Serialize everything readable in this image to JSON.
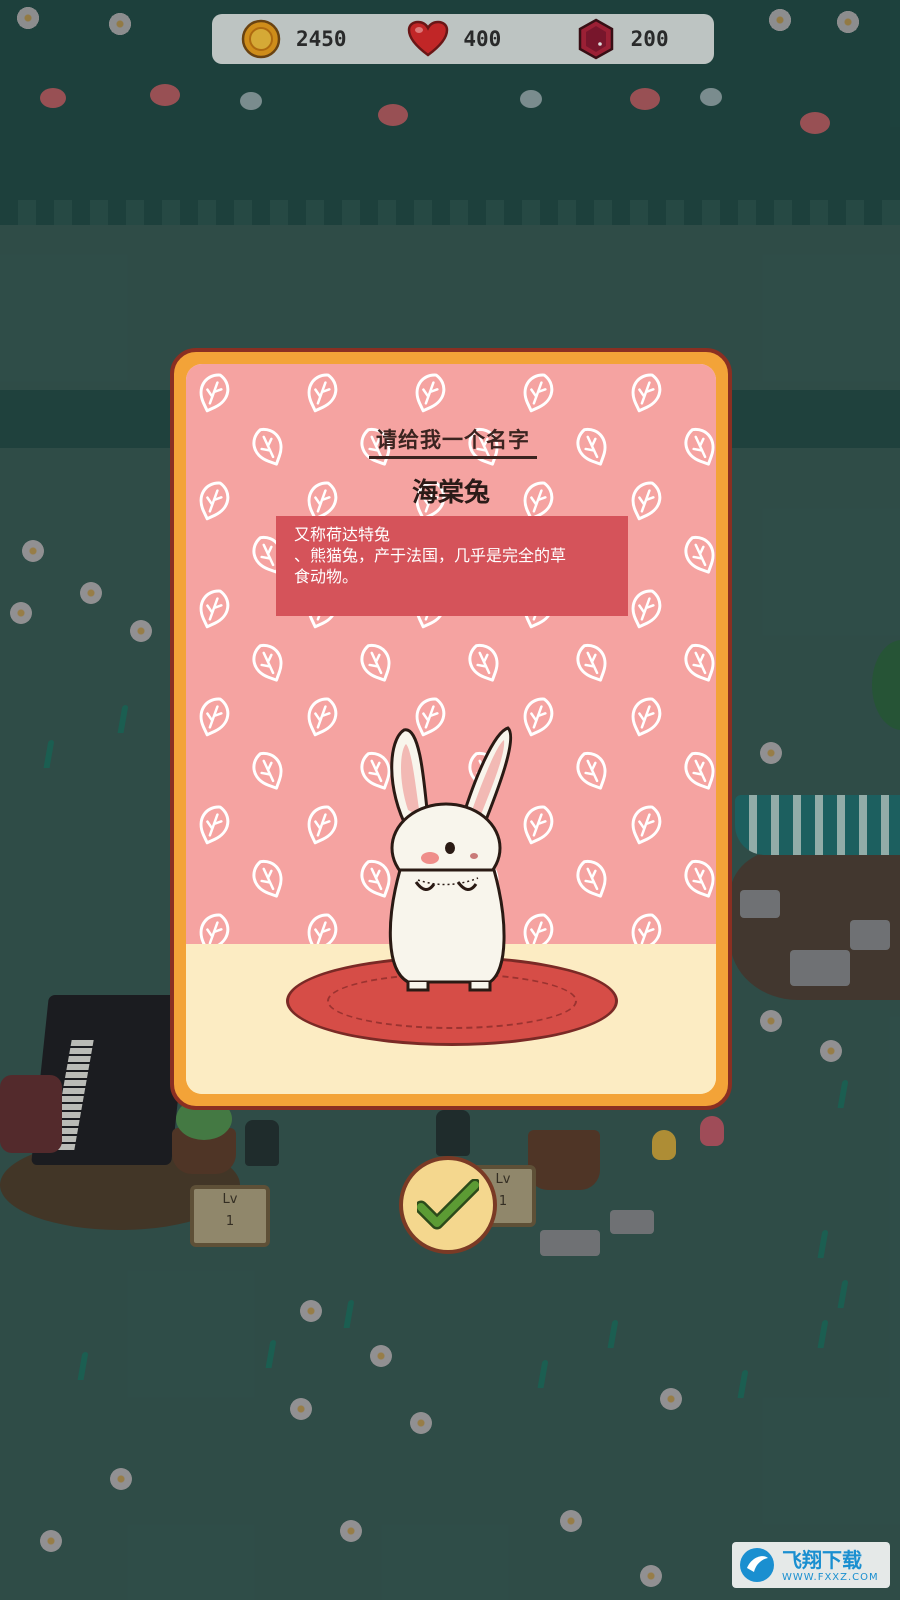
{
  "hud": {
    "coins": {
      "icon": "gold-coin-icon",
      "value": "2450"
    },
    "hearts": {
      "icon": "heart-icon",
      "value": "400"
    },
    "gems": {
      "icon": "ruby-gem-icon",
      "value": "200"
    }
  },
  "dialog": {
    "prompt": "请给我一个名字",
    "pet_name": "海棠兔",
    "description_lines": [
      "又称荷达特兔",
      "、熊猫兔，产于法国，几乎是完全的草",
      "食动物。"
    ],
    "confirm_icon": "checkmark-icon"
  },
  "scene": {
    "left_sign": {
      "label": "Lv",
      "level": "1"
    },
    "right_sign": {
      "label": "Lv",
      "level": "1"
    }
  },
  "watermark": {
    "brand": "飞翔下载",
    "url": "WWW.FXXZ.COM"
  },
  "colors": {
    "card_border": "#f3a338",
    "wallpaper": "#f5a3a1",
    "description_bg": "#d5535a",
    "rug": "#d64d47",
    "confirm_check": "#4c8b2b"
  }
}
